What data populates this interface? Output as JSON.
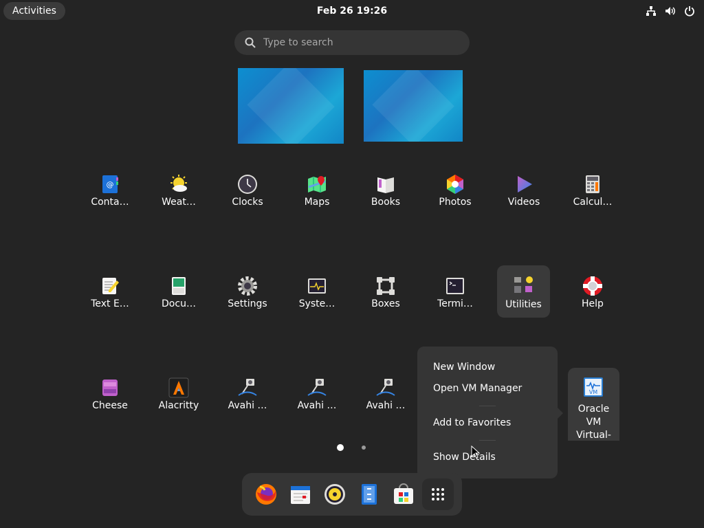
{
  "topbar": {
    "activities": "Activities",
    "clock": "Feb 26  19:26"
  },
  "search": {
    "placeholder": "Type to search"
  },
  "apps": [
    {
      "label": "Conta…",
      "icon": "contacts-icon"
    },
    {
      "label": "Weat…",
      "icon": "weather-icon"
    },
    {
      "label": "Clocks",
      "icon": "clocks-icon"
    },
    {
      "label": "Maps",
      "icon": "maps-icon"
    },
    {
      "label": "Books",
      "icon": "books-icon"
    },
    {
      "label": "Photos",
      "icon": "photos-icon"
    },
    {
      "label": "Videos",
      "icon": "videos-icon"
    },
    {
      "label": "Calcul…",
      "icon": "calculator-icon"
    },
    {
      "label": "Text E…",
      "icon": "text-editor-icon"
    },
    {
      "label": "Docu…",
      "icon": "document-viewer-icon"
    },
    {
      "label": "Settings",
      "icon": "settings-icon"
    },
    {
      "label": "Syste…",
      "icon": "system-monitor-icon"
    },
    {
      "label": "Boxes",
      "icon": "boxes-icon"
    },
    {
      "label": "Termi…",
      "icon": "terminal-icon"
    },
    {
      "label": "Utilities",
      "icon": "utilities-folder-icon"
    },
    {
      "label": "Help",
      "icon": "help-icon"
    },
    {
      "label": "Cheese",
      "icon": "cheese-icon"
    },
    {
      "label": "Alacritty",
      "icon": "alacritty-icon"
    },
    {
      "label": "Avahi …",
      "icon": "avahi-icon"
    },
    {
      "label": "Avahi …",
      "icon": "avahi-icon"
    },
    {
      "label": "Avahi …",
      "icon": "avahi-icon"
    }
  ],
  "context_menu": {
    "new_window": "New Window",
    "open_vm_manager": "Open VM Manager",
    "add_to_favorites": "Add to Favorites",
    "show_details": "Show Details"
  },
  "vbox": {
    "label_line1": "Oracle",
    "label_line2": "VM",
    "label_line3": "Virtual-"
  },
  "dock": [
    "firefox-icon",
    "calendar-icon",
    "rhythmbox-icon",
    "files-icon",
    "software-icon",
    "show-apps-icon"
  ],
  "colors": {
    "background": "#242424",
    "panel": "#353535",
    "accent_blue": "#1c71d8"
  }
}
